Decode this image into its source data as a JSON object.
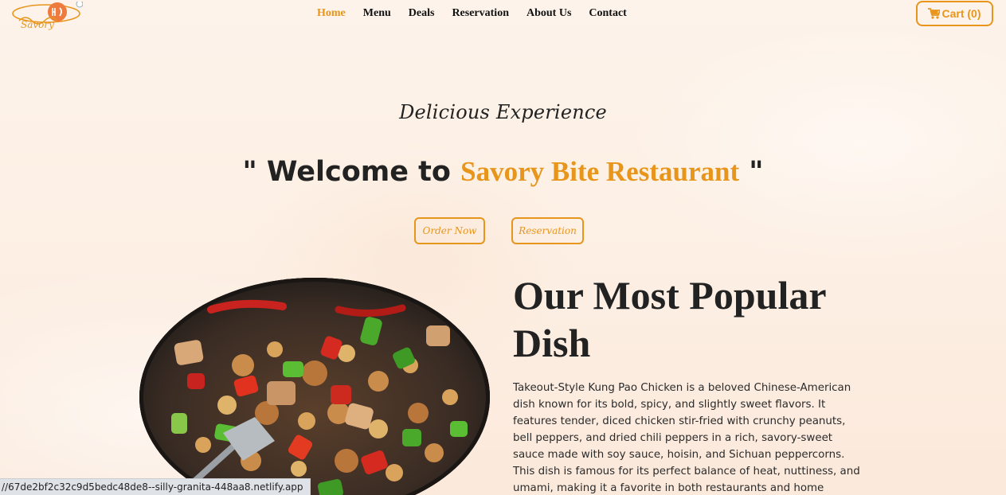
{
  "nav": {
    "logo_alt": "Savory",
    "links": [
      {
        "label": "Home",
        "active": true
      },
      {
        "label": "Menu",
        "active": false
      },
      {
        "label": "Deals",
        "active": false
      },
      {
        "label": "Reservation",
        "active": false
      },
      {
        "label": "About Us",
        "active": false
      },
      {
        "label": "Contact",
        "active": false
      }
    ],
    "cart_label": "Cart (0)",
    "cart_icon": "cart-icon"
  },
  "hero": {
    "tagline": "Delicious Experience",
    "welcome_prefix": "\" Welcome to ",
    "brand_name": "Savory Bite Restaurant",
    "welcome_suffix": " \"",
    "order_button": "Order Now",
    "reservation_button": "Reservation"
  },
  "popular": {
    "title": "Our Most Popular Dish",
    "description": "Takeout-Style Kung Pao Chicken is a beloved Chinese-American dish known for its bold, spicy, and slightly sweet flavors. It features tender, diced chicken stir-fried with crunchy peanuts, bell peppers, and dried chili peppers in a rich, savory-sweet sauce made with soy sauce, hoisin, and Sichuan peppercorns. This dish is famous for its perfect balance of heat, nuttiness, and umami, making it a favorite in both restaurants and home kitchens worldwide.",
    "image_subject": "kung-pao-chicken-wok"
  },
  "status_bar": {
    "url": "//67de2bf2c32c9d5bedc48de8--silly-granita-448aa8.netlify.app"
  },
  "colors": {
    "accent": "#e8951c",
    "text": "#222222",
    "background": "#fdf1e6"
  }
}
